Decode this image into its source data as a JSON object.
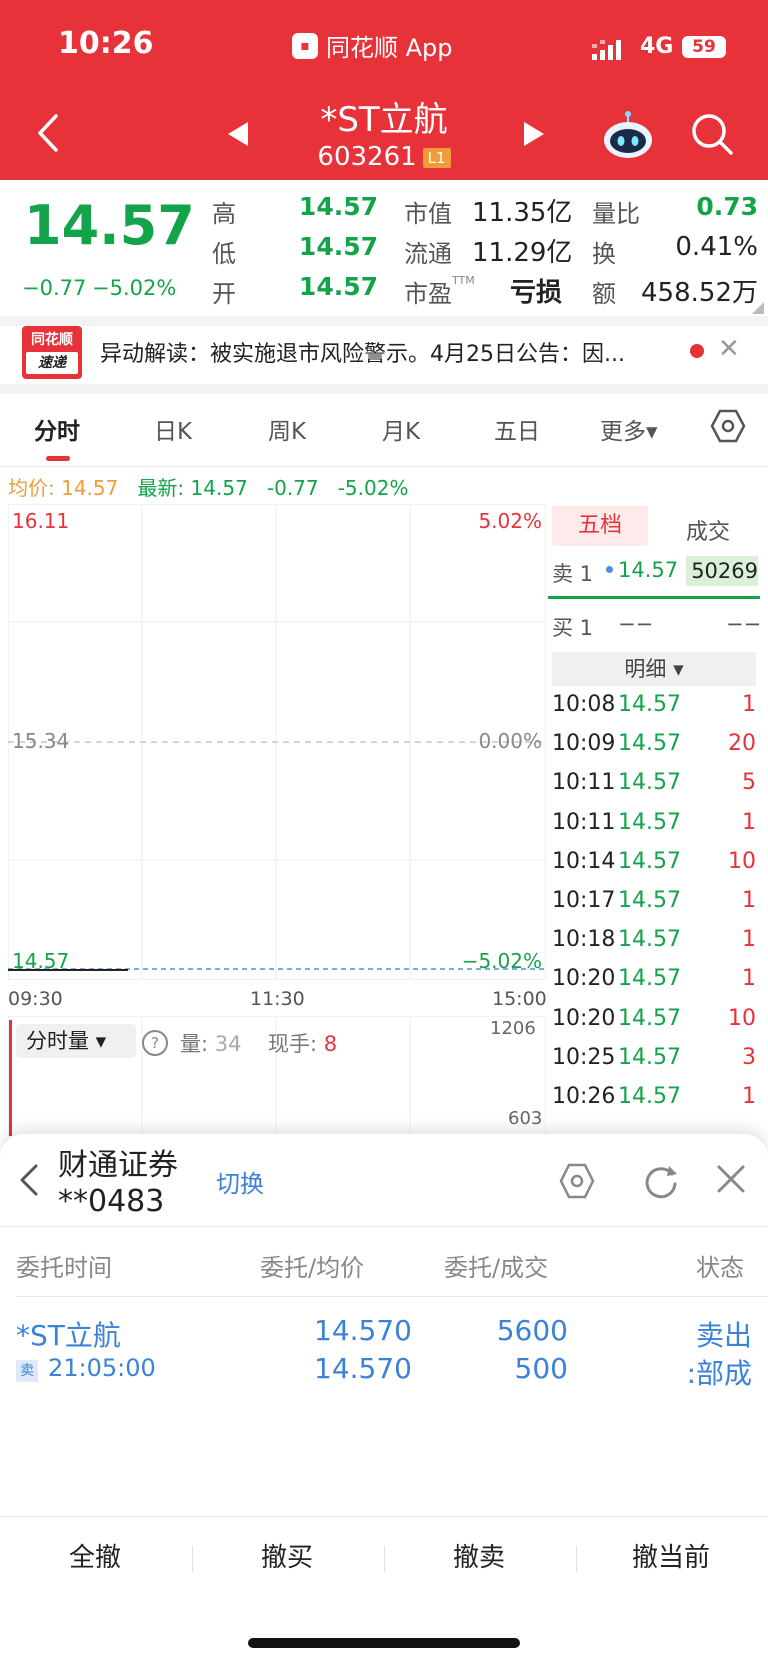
{
  "status_bar": {
    "time": "10:26",
    "app_name": "同花顺 App",
    "network": "4G",
    "battery": "59"
  },
  "header": {
    "stock_name": "*ST立航",
    "stock_code": "603261",
    "level_badge": "L1"
  },
  "quote": {
    "price": "14.57",
    "change": "−0.77",
    "change_pct": "−5.02%",
    "high_label": "高",
    "high": "14.57",
    "low_label": "低",
    "low": "14.57",
    "open_label": "开",
    "open": "14.57",
    "mktcap_label": "市值",
    "mktcap": "11.35亿",
    "float_label": "流通",
    "float": "11.29亿",
    "pe_label": "市盈",
    "pe_suffix": "TTM",
    "pe": "亏损",
    "volratio_label": "量比",
    "volratio": "0.73",
    "turnover_label": "换",
    "turnover": "0.41%",
    "amount_label": "额",
    "amount": "458.52万"
  },
  "news": {
    "logo_top": "同花顺",
    "logo_bottom": "速递",
    "text": "异动解读：被实施退市风险警示。4月25日公告：因...",
    "close": "✕"
  },
  "tabs": [
    {
      "label": "分时",
      "active": true
    },
    {
      "label": "日K"
    },
    {
      "label": "周K"
    },
    {
      "label": "月K"
    },
    {
      "label": "五日"
    },
    {
      "label": "更多▾"
    }
  ],
  "legend": {
    "avg": "均价: 14.57",
    "latest": "最新: 14.57",
    "chg": "-0.77",
    "pct": "-5.02%"
  },
  "chart": {
    "y_top": "16.11",
    "y_mid": "15.34",
    "y_bottom": "14.57",
    "pct_top": "5.02%",
    "pct_mid": "0.00%",
    "pct_bottom": "−5.02%",
    "x_labels": [
      "09:30",
      "11:30",
      "15:00"
    ],
    "colors": {
      "up": "#e8323a",
      "down": "#13a34a",
      "avg": "#4a90e2"
    }
  },
  "chart_data": {
    "type": "line",
    "title": "",
    "x": [
      "09:30",
      "09:31"
    ],
    "series": [
      {
        "values": [
          14.57,
          14.57
        ]
      }
    ],
    "ylim": [
      14.57,
      16.11
    ],
    "x_ticks": [
      "09:30",
      "11:30",
      "15:00"
    ]
  },
  "volume": {
    "selector": "分时量 ▾",
    "help": "?",
    "vol_label": "量:",
    "vol_value": "34",
    "hand_label": "现手:",
    "hand_value": "8",
    "max": "1206",
    "mid": "603"
  },
  "order_book": {
    "tab_five": "五档",
    "tab_deal": "成交",
    "ask_label": "卖 1",
    "ask_price": "14.57",
    "ask_vol": "50269",
    "bid_label": "买 1",
    "bid_price": "−−",
    "bid_vol": "−−",
    "detail_label": "明细 ▾"
  },
  "ticks": [
    {
      "time": "10:08",
      "price": "14.57",
      "vol": "1"
    },
    {
      "time": "10:09",
      "price": "14.57",
      "vol": "20"
    },
    {
      "time": "10:11",
      "price": "14.57",
      "vol": "5"
    },
    {
      "time": "10:11",
      "price": "14.57",
      "vol": "1"
    },
    {
      "time": "10:14",
      "price": "14.57",
      "vol": "10"
    },
    {
      "time": "10:17",
      "price": "14.57",
      "vol": "1"
    },
    {
      "time": "10:18",
      "price": "14.57",
      "vol": "1"
    },
    {
      "time": "10:20",
      "price": "14.57",
      "vol": "1"
    },
    {
      "time": "10:20",
      "price": "14.57",
      "vol": "10"
    },
    {
      "time": "10:25",
      "price": "14.57",
      "vol": "3"
    },
    {
      "time": "10:26",
      "price": "14.57",
      "vol": "1"
    }
  ],
  "sheet": {
    "broker": "财通证券",
    "account": "**0483",
    "switch": "切换",
    "headers": {
      "time": "委托时间",
      "price": "委托/均价",
      "qty": "委托/成交",
      "status": "状态"
    },
    "order": {
      "name": "*ST立航",
      "side": "卖",
      "time": "21:05:00",
      "price": "14.570",
      "avg_price": "14.570",
      "qty": "5600",
      "filled": "500",
      "status1": "卖出",
      "status2": ":部成"
    },
    "buttons": [
      "全撤",
      "撤买",
      "撤卖",
      "撤当前"
    ]
  }
}
